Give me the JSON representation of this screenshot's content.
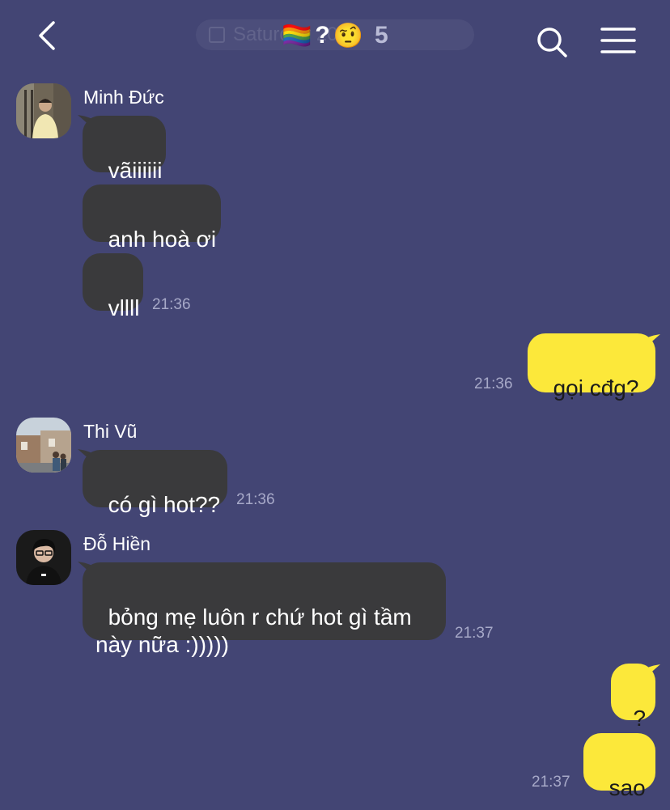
{
  "header": {
    "date_chip": "Saturday 2025",
    "title_flag": "🏳️‍🌈",
    "title_question": "?",
    "title_emoji": "🤨",
    "member_count": "5"
  },
  "messages": {
    "g1": {
      "sender": "Minh Đức",
      "m1": "vãiiiiii",
      "m2": "anh hoà ơi",
      "m3": "vllll",
      "time": "21:36"
    },
    "o1": {
      "text": "gọi cđg?",
      "time": "21:36"
    },
    "g2": {
      "sender": "Thi Vũ",
      "m1": "có gì hot??",
      "time": "21:36"
    },
    "g3": {
      "sender": "Đỗ Hiền",
      "m1": "bỏng mẹ luôn r chứ hot gì tầm\nnày nữa :)))))",
      "time": "21:37"
    },
    "o2": {
      "m1": "?",
      "m2": "sao",
      "time": "21:37"
    }
  },
  "colors": {
    "background": "#434574",
    "incoming_bubble": "#3a3a3c",
    "outgoing_bubble": "#fce83a",
    "timestamp": "#a7a9c8"
  },
  "icons": [
    "back-icon",
    "calendar-icon",
    "search-icon",
    "menu-icon"
  ]
}
